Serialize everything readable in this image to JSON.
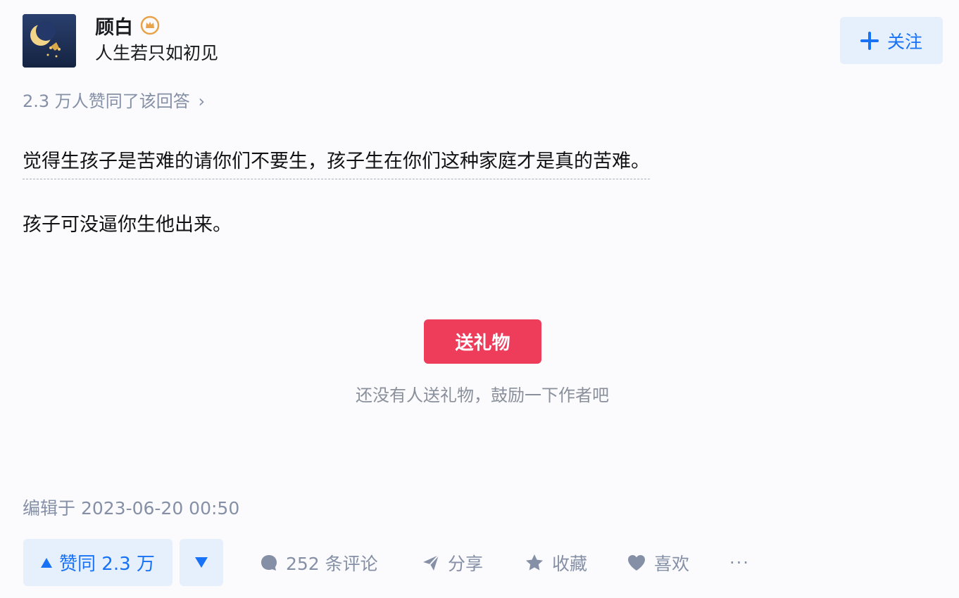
{
  "author": {
    "name": "顾白",
    "bio": "人生若只如初见",
    "badge_icon": "crown-badge-icon"
  },
  "follow": {
    "label": "关注"
  },
  "upvote_summary": {
    "text": "2.3 万人赞同了该回答",
    "chevron": "›"
  },
  "content": {
    "paragraphs": [
      "觉得生孩子是苦难的请你们不要生，孩子生在你们这种家庭才是真的苦难。",
      "孩子可没逼你生他出来。"
    ]
  },
  "gift": {
    "button_label": "送礼物",
    "hint": "还没有人送礼物，鼓励一下作者吧"
  },
  "edit_time": "编辑于 2023-06-20 00:50",
  "actions": {
    "upvote_label": "赞同 2.3 万",
    "comments_label": "252 条评论",
    "share_label": "分享",
    "favorite_label": "收藏",
    "like_label": "喜欢",
    "more_label": "···"
  },
  "colors": {
    "accent": "#1772f6",
    "gift": "#ee3d5b",
    "muted": "#8590a6"
  }
}
